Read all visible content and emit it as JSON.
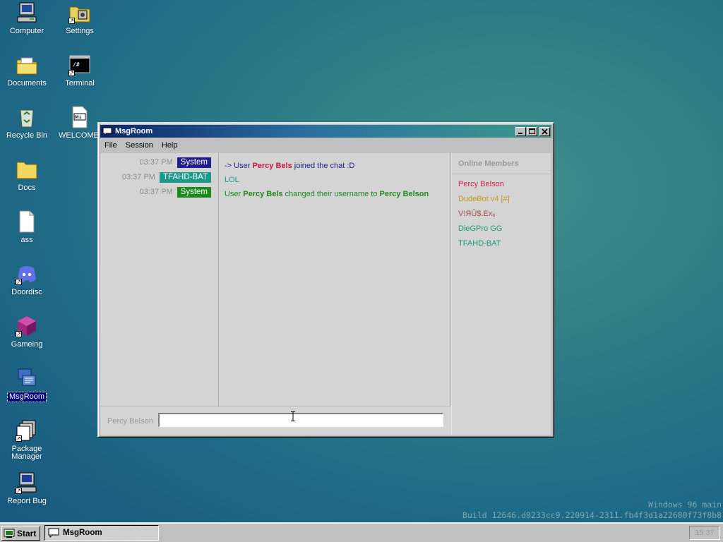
{
  "desktop": {
    "icons": [
      {
        "label": "Computer"
      },
      {
        "label": "Settings"
      },
      {
        "label": "Documents"
      },
      {
        "label": "Terminal"
      },
      {
        "label": "Recycle Bin"
      },
      {
        "label": "WELCOME."
      },
      {
        "label": "Docs"
      },
      {
        "label": "ass"
      },
      {
        "label": "Doordisc"
      },
      {
        "label": "Gameing"
      },
      {
        "label": "MsgRoom"
      },
      {
        "label": "Package Manager"
      },
      {
        "label": "Report Bug"
      }
    ]
  },
  "window": {
    "title": "MsgRoom",
    "menu": [
      "File",
      "Session",
      "Help"
    ],
    "messages": [
      {
        "time": "03:37 PM",
        "sender": "System",
        "sender_color": "#1e1e8c",
        "parts": [
          "-> User ",
          "Percy Bels",
          " joined the chat :D"
        ],
        "text_color": "#1e1e8c",
        "highlight_color": "#cc1144"
      },
      {
        "time": "03:37 PM",
        "sender": "TFAHD-BAT",
        "sender_color": "#1a9a8a",
        "parts": [
          "LOL"
        ],
        "text_color": "#1a9a8a"
      },
      {
        "time": "03:37 PM",
        "sender": "System",
        "sender_color": "#1e8a1e",
        "parts": [
          "User ",
          "Percy Bels",
          " changed their username to ",
          "Percy Belson"
        ],
        "text_color": "#1e8a1e"
      }
    ],
    "members_title": "Online Members",
    "members": [
      {
        "name": "Percy Belson",
        "color": "#d0204a"
      },
      {
        "name": "DudeBot v4 [#]",
        "color": "#c89a1a"
      },
      {
        "name": "V!ЯÛ$.Ex₆",
        "color": "#a05050"
      },
      {
        "name": "DieGPro GG",
        "color": "#1a9a7a"
      },
      {
        "name": "TFAHD-BAT",
        "color": "#1a9a7a"
      }
    ],
    "composer": {
      "username": "Percy Belson",
      "input_value": ""
    }
  },
  "watermark": {
    "line1": "Windows 96 main",
    "line2": "Build 12646.d0233cc9.220914-2311.fb4f3d1a22680f73f8b8"
  },
  "taskbar": {
    "start_label": "Start",
    "task_label": "MsgRoom",
    "clock": "15:37"
  }
}
